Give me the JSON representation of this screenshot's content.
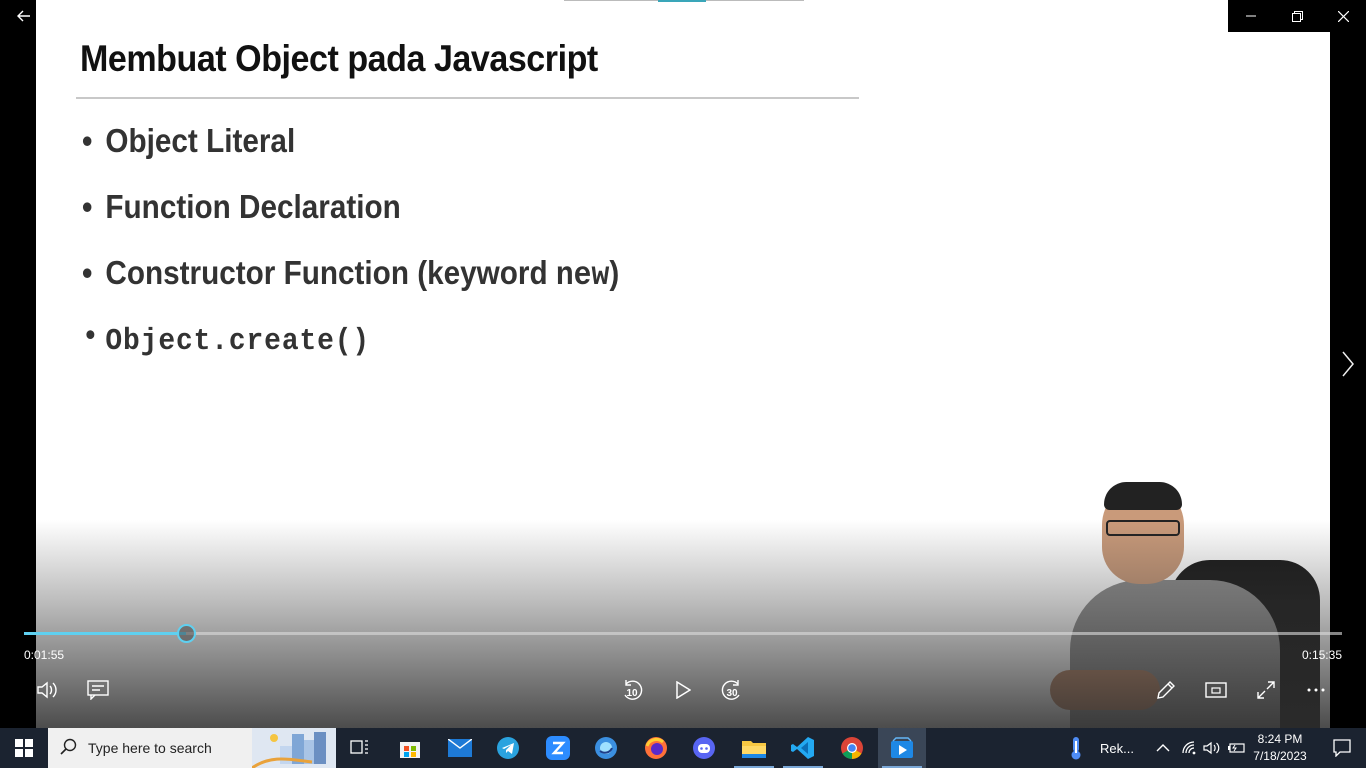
{
  "slide": {
    "title": "Membuat Object pada Javascript",
    "bullets": [
      {
        "text": "Object Literal"
      },
      {
        "text": "Function Declaration"
      },
      {
        "text": "Constructor Function (keyword ",
        "code": "new",
        "suffix": ")"
      },
      {
        "text": "Object.create()"
      }
    ]
  },
  "player": {
    "current_time": "0:01:55",
    "total_time": "0:15:35",
    "progress_fraction": 0.123,
    "skip_back_seconds": "10",
    "skip_forward_seconds": "30"
  },
  "taskbar": {
    "search_placeholder": "Type here to search",
    "weather_label": "Rek...",
    "time": "8:24 PM",
    "date": "7/18/2023"
  },
  "colors": {
    "accent": "#5fd0f0",
    "taskbar_bg": "#1b2330"
  }
}
